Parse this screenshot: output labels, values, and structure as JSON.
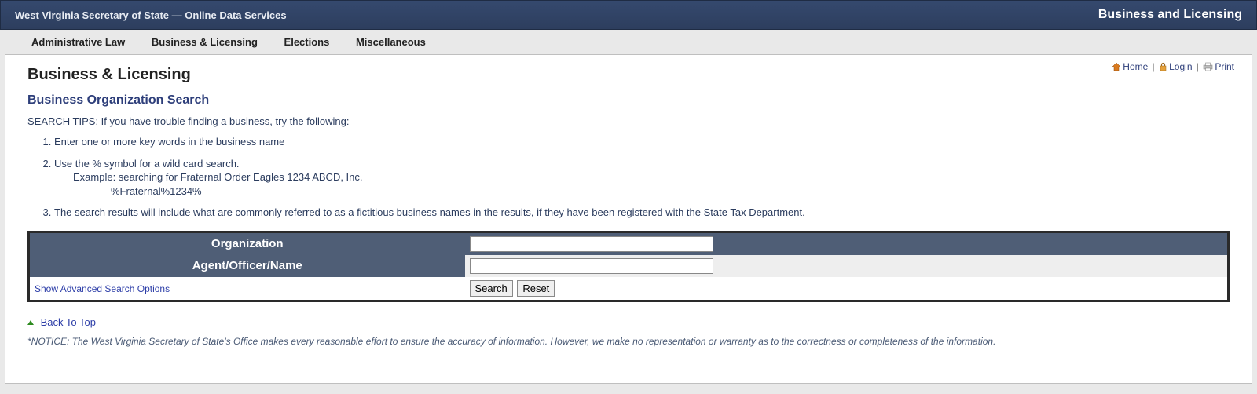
{
  "banner": {
    "site_title": "West Virginia Secretary of State — Online Data Services",
    "section_title": "Business and Licensing"
  },
  "menu": {
    "items": [
      "Administrative Law",
      "Business & Licensing",
      "Elections",
      "Miscellaneous"
    ]
  },
  "util": {
    "home": "Home",
    "login": "Login",
    "print": "Print"
  },
  "page": {
    "heading": "Business & Licensing",
    "subheading": "Business Organization Search",
    "tips_intro": "SEARCH TIPS: If you have trouble finding a business, try the following:",
    "tips": {
      "t1": "Enter one or more key words in the business name",
      "t2_line1": "Use the % symbol for a wild card search.",
      "t2_line2": "Example: searching for Fraternal Order Eagles 1234 ABCD, Inc.",
      "t2_line3": "%Fraternal%1234%",
      "t3": "The search results will include what are commonly referred to as a fictitious business names in the results, if they have been registered with the State Tax Department."
    }
  },
  "form": {
    "org_label": "Organization",
    "agent_label": "Agent/Officer/Name",
    "org_value": "",
    "agent_value": "",
    "advanced_link": "Show Advanced Search Options",
    "search_btn": "Search",
    "reset_btn": "Reset"
  },
  "footer": {
    "back_top": "Back To Top",
    "notice": "*NOTICE: The West Virginia Secretary of State's Office makes every reasonable effort to ensure the accuracy of information. However, we make no representation or warranty as to the correctness or completeness of the information."
  }
}
